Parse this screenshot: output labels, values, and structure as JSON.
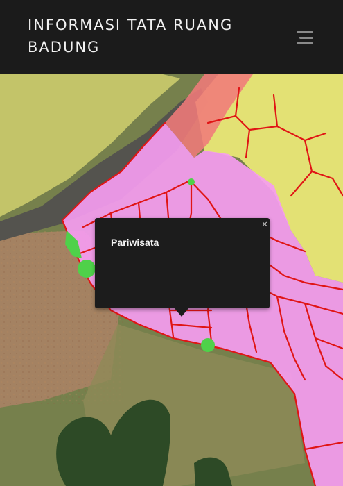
{
  "header": {
    "title": "INFORMASI TATA RUANG BADUNG",
    "menu_icon": "hamburger-menu-icon"
  },
  "popup": {
    "label": "Pariwisata",
    "close_label": "×",
    "close_icon": "close-icon"
  },
  "map": {
    "zone_colors": {
      "pariwisata": "#f59cf0",
      "yellow_zone": "#f2ee7a",
      "salmon_zone": "#f07a7a",
      "green_zone": "#4fd14a",
      "road": "#e01515"
    }
  }
}
